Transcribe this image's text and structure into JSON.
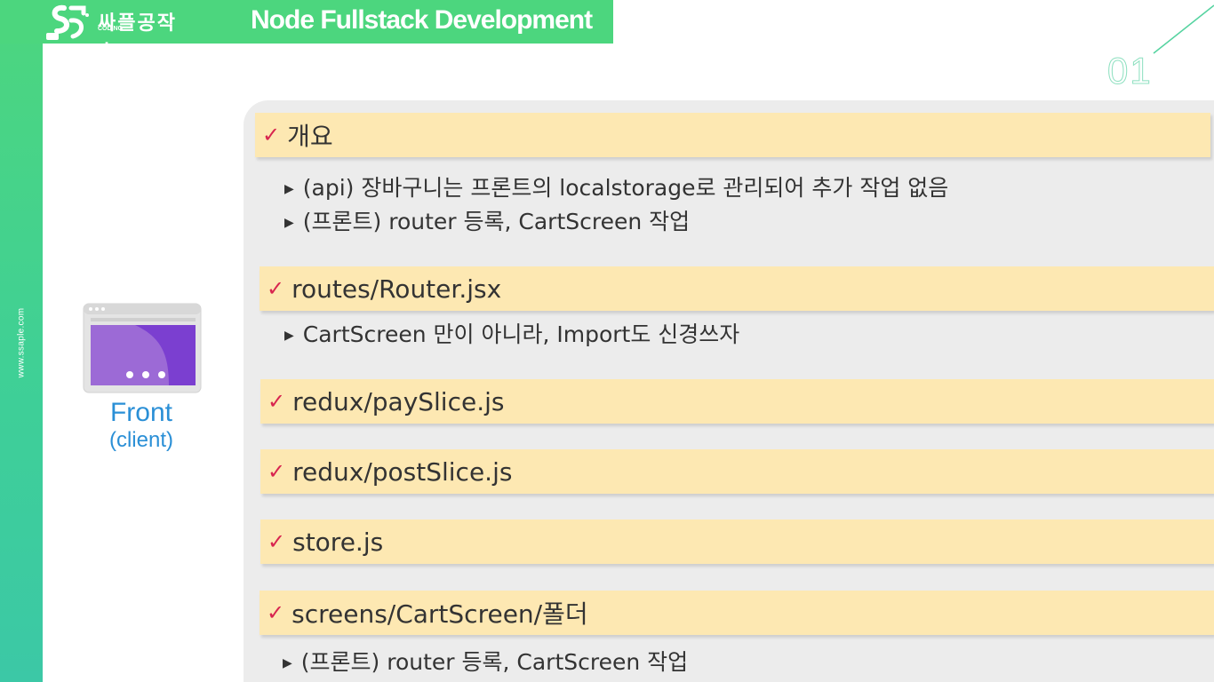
{
  "header": {
    "logo_text": "싸플공작소",
    "logo_sub": "CODING",
    "title": "Node Fullstack Development",
    "page_number": "01"
  },
  "side": {
    "url": "www.ssaple.com"
  },
  "left": {
    "label": "Front",
    "sublabel": "(client)"
  },
  "sections": [
    {
      "title": "개요",
      "items": [
        "(api) 장바구니는 프론트의 localstorage로 관리되어 추가 작업 없음",
        "(프론트) router 등록, CartScreen 작업"
      ]
    },
    {
      "title": "routes/Router.jsx",
      "items": [
        "CartScreen 만이 아니라, Import도 신경쓰자"
      ]
    },
    {
      "title": "redux/paySlice.js",
      "items": []
    },
    {
      "title": "redux/postSlice.js",
      "items": []
    },
    {
      "title": "store.js",
      "items": []
    },
    {
      "title": "screens/CartScreen/폴더",
      "items": [
        "(프론트) router 등록, CartScreen 작업"
      ]
    }
  ],
  "colors": {
    "accent_green": "#4cd67e",
    "check_red": "#d8254f",
    "highlight": "#fde8b2",
    "label_blue": "#2a8fd6"
  }
}
